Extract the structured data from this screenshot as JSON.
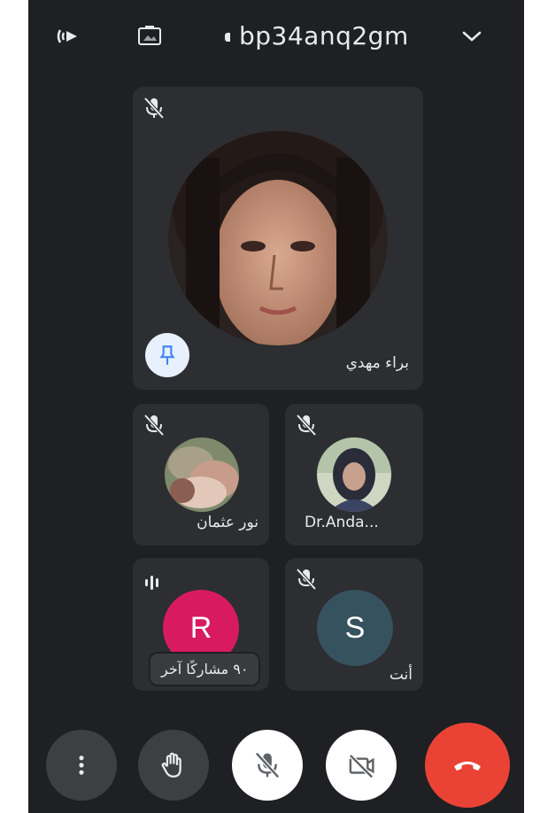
{
  "meeting": {
    "code": "bp34anq2gm"
  },
  "participants": {
    "main": {
      "name": "براء مهدي"
    },
    "p2": {
      "name": "نور عثمان"
    },
    "p3": {
      "name": "Dr.Anda..."
    },
    "p4": {
      "initial": "R"
    },
    "p5": {
      "initial": "S",
      "name": "أنت"
    }
  },
  "others_label": "٩٠ مشاركًا آخر",
  "colors": {
    "background": "#1f2023",
    "tile": "#2d2e31",
    "end_call": "#ea4335",
    "avatar_r": "#d81b60",
    "avatar_s": "#37525f"
  },
  "icons": [
    "participants-icon",
    "screen-icon",
    "chevron-down-icon",
    "mic-off-icon",
    "pin-icon",
    "more-options-icon",
    "raise-hand-icon",
    "camera-off-icon",
    "end-call-icon",
    "audio-wave-icon"
  ]
}
